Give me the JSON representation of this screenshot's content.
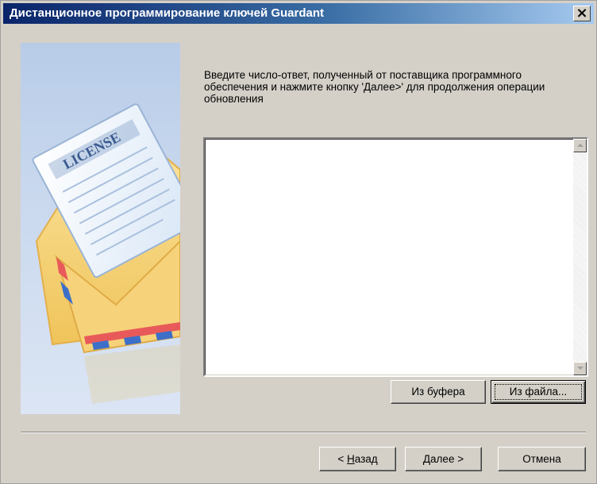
{
  "window": {
    "title": "Дистанционное программирование ключей Guardant",
    "close_glyph": "×"
  },
  "side_image": {
    "license_label": "LICENSE"
  },
  "instruction": "Введите число-ответ, полученный от поставщика программного обеспечения и нажмите кнопку 'Далее>' для продолжения операции обновления",
  "answer_field": {
    "value": ""
  },
  "buttons": {
    "from_buffer": "Из буфера",
    "from_file": "Из файла...",
    "back_prefix": "< ",
    "back_accel": "Н",
    "back_rest": "азад",
    "next_accel": "Д",
    "next_rest": "алее >",
    "cancel": "Отмена"
  },
  "colors": {
    "title_start": "#0a246a",
    "title_end": "#a6caf0",
    "dialog_bg": "#d4d0c8"
  }
}
